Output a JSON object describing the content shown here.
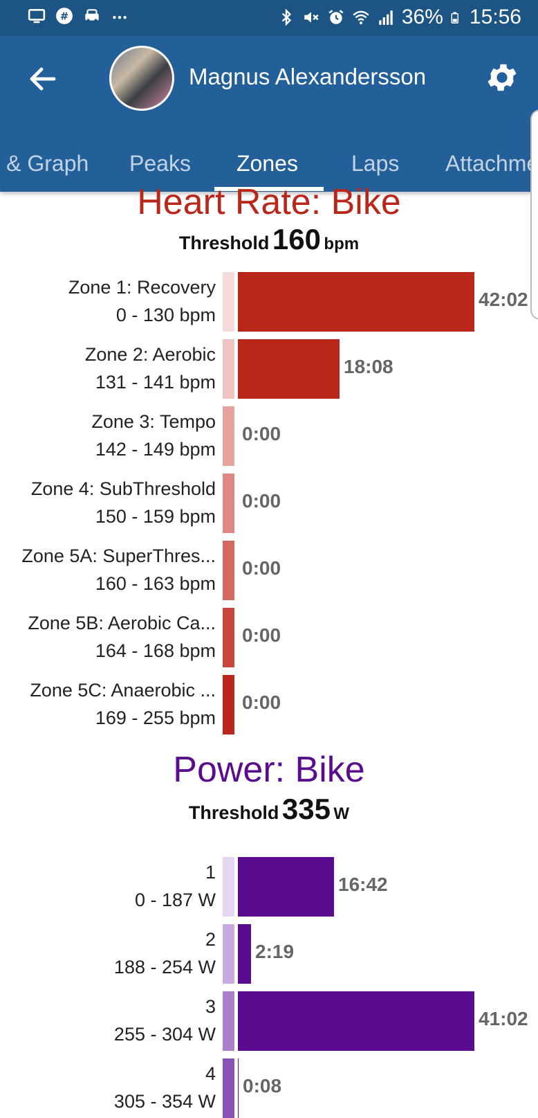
{
  "status_bar": {
    "battery": "36%",
    "time": "15:56",
    "left_icons": [
      "monitor-icon",
      "slack-icon",
      "car-icon",
      "more-dots-icon"
    ],
    "right_icons": [
      "bluetooth-icon",
      "mute-icon",
      "alarm-icon",
      "wifi-icon",
      "signal-icon",
      "battery-icon"
    ]
  },
  "header": {
    "user_name": "Magnus Alexandersson"
  },
  "tabs": [
    {
      "label": "Map & Graph"
    },
    {
      "label": "Peaks"
    },
    {
      "label": "Zones",
      "active": true
    },
    {
      "label": "Laps"
    },
    {
      "label": "Attachments"
    }
  ],
  "heart_rate": {
    "title": "Heart Rate: Bike",
    "threshold_label": "Threshold",
    "threshold_value": "160",
    "threshold_unit": "bpm",
    "color": "#b9261a",
    "zones": [
      {
        "name": "Zone 1: Recovery",
        "range": "0 - 130 bpm",
        "time": "42:02",
        "fraction": 1.0,
        "swatch": "#f5dcda"
      },
      {
        "name": "Zone 2: Aerobic",
        "range": "131 - 141 bpm",
        "time": "18:08",
        "fraction": 0.43,
        "swatch": "#efc3bf"
      },
      {
        "name": "Zone 3: Tempo",
        "range": "142 - 149 bpm",
        "time": "0:00",
        "fraction": 0,
        "swatch": "#e6a39d"
      },
      {
        "name": "Zone 4: SubThreshold",
        "range": "150 - 159 bpm",
        "time": "0:00",
        "fraction": 0,
        "swatch": "#dd8880"
      },
      {
        "name": "Zone 5A: SuperThres...",
        "range": "160 - 163 bpm",
        "time": "0:00",
        "fraction": 0,
        "swatch": "#d36960"
      },
      {
        "name": "Zone 5B: Aerobic Ca...",
        "range": "164 - 168 bpm",
        "time": "0:00",
        "fraction": 0,
        "swatch": "#c8473c"
      },
      {
        "name": "Zone 5C: Anaerobic ...",
        "range": "169 - 255 bpm",
        "time": "0:00",
        "fraction": 0,
        "swatch": "#b9261a"
      }
    ]
  },
  "power": {
    "title": "Power: Bike",
    "threshold_label": "Threshold",
    "threshold_value": "335",
    "threshold_unit": "W",
    "color": "#5a0c8f",
    "zones": [
      {
        "name": "1",
        "range": "0 - 187 W",
        "time": "16:42",
        "fraction": 0.407,
        "swatch": "#e6d6ef"
      },
      {
        "name": "2",
        "range": "188 - 254 W",
        "time": "2:19",
        "fraction": 0.056,
        "swatch": "#c8a9e0"
      },
      {
        "name": "3",
        "range": "255 - 304 W",
        "time": "41:02",
        "fraction": 1.0,
        "swatch": "#aa80cc"
      },
      {
        "name": "4",
        "range": "305 - 354 W",
        "time": "0:08",
        "fraction": 0.004,
        "swatch": "#8a52b8"
      }
    ]
  }
}
